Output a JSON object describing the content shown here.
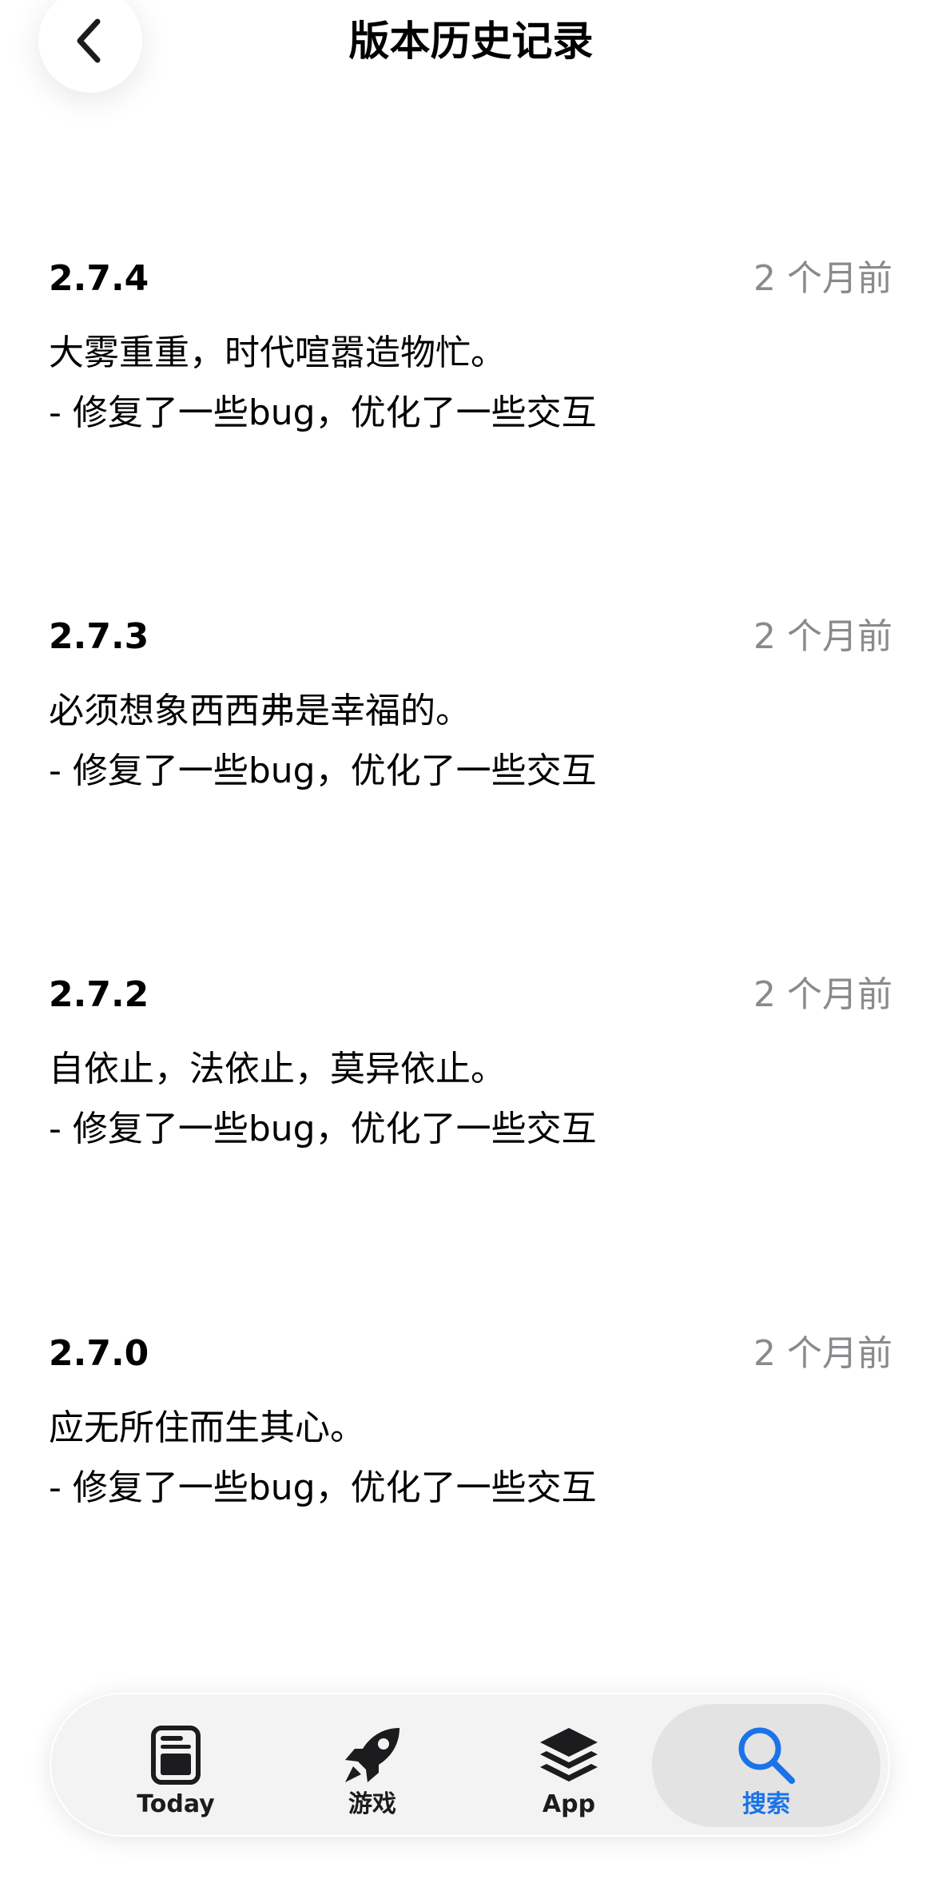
{
  "header": {
    "title": "版本历史记录"
  },
  "releases": [
    {
      "version": "2.7.4",
      "date": "2 个月前",
      "lines": [
        "大雾重重，时代喧嚣造物忙。",
        "- 修复了一些bug，优化了一些交互"
      ]
    },
    {
      "version": "2.7.3",
      "date": "2 个月前",
      "lines": [
        "必须想象西西弗是幸福的。",
        "- 修复了一些bug，优化了一些交互"
      ]
    },
    {
      "version": "2.7.2",
      "date": "2 个月前",
      "lines": [
        "自依止，法依止，莫异依止。",
        "- 修复了一些bug，优化了一些交互"
      ]
    },
    {
      "version": "2.7.0",
      "date": "2 个月前",
      "lines": [
        "应无所住而生其心。",
        "- 修复了一些bug，优化了一些交互"
      ]
    }
  ],
  "tabbar": {
    "tabs": [
      {
        "label": "Today",
        "icon": "today-icon"
      },
      {
        "label": "游戏",
        "icon": "rocket-icon"
      },
      {
        "label": "App",
        "icon": "layers-icon"
      },
      {
        "label": "搜索",
        "icon": "search-icon",
        "selected": true
      }
    ]
  },
  "colors": {
    "accent": "#1a73e8",
    "secondary_text": "#8a8a8e",
    "tab_bar_bg": "#f3f3f3",
    "tab_selected_bg": "#e3e3e3"
  }
}
